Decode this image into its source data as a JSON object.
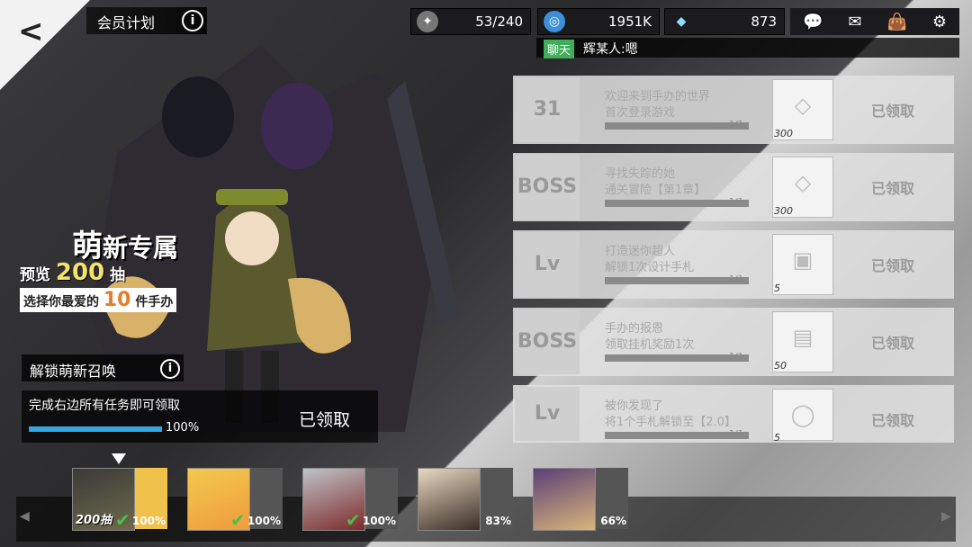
{
  "header": {
    "title": "会员计划"
  },
  "resources": [
    {
      "icon": "stamina-icon",
      "value": "53/240"
    },
    {
      "icon": "coin-icon",
      "value": "1951K"
    },
    {
      "icon": "diamond-icon",
      "value": "873"
    }
  ],
  "top_icons": [
    "chat-icon",
    "mail-icon",
    "bag-icon",
    "settings-icon"
  ],
  "chat": {
    "channel": "聊天",
    "message": "辉某人:嗯"
  },
  "promo": {
    "line1_big": "萌",
    "line1_rest": "新专属",
    "line2_prefix": "预览",
    "line2_num": "200",
    "line2_suffix": "抽",
    "line3_prefix": "选择你最爱的",
    "line3_num": "10",
    "line3_suffix": "件手办"
  },
  "unlock": {
    "label": "解锁萌新召唤"
  },
  "reward": {
    "desc": "完成右边所有任务即可领取",
    "progress": "100%",
    "progress_fraction": 1.0,
    "claim": "已领取"
  },
  "tasks": [
    {
      "icon": "calendar-icon",
      "line1": "欢迎来到手办的世界",
      "line2": "首次登录游戏",
      "count": "1/1",
      "item_icon": "diamond-icon",
      "qty": "300",
      "status": "已领取"
    },
    {
      "icon": "boss-icon",
      "line1": "寻找失踪的她",
      "line2": "通关冒险【第1章】",
      "count": "1/1",
      "item_icon": "diamond-icon",
      "qty": "300",
      "status": "已领取"
    },
    {
      "icon": "level-icon",
      "line1": "打造迷你超人",
      "line2": "解锁1次设计手札",
      "count": "1/1",
      "item_icon": "bottle-icon",
      "qty": "5",
      "status": "已领取"
    },
    {
      "icon": "boss-icon",
      "line1": "手办的报恩",
      "line2": "领取挂机奖励1次",
      "count": "1/1",
      "item_icon": "card-icon",
      "qty": "50",
      "status": "已领取"
    },
    {
      "icon": "level-icon",
      "line1": "被你发现了",
      "line2": "将1个手札解锁至【2.0】",
      "count": "1/1",
      "item_icon": "figure-head-icon",
      "qty": "5",
      "status": "已领取"
    }
  ],
  "icon_text": {
    "calendar-icon": "31",
    "boss-icon": "BOSS",
    "level-icon": "Lv"
  },
  "chips": [
    {
      "label": "200抽",
      "percent": "100%",
      "checked": true,
      "selected": true
    },
    {
      "percent": "100%",
      "checked": true
    },
    {
      "percent": "100%",
      "checked": true
    },
    {
      "percent": "83%",
      "checked": false
    },
    {
      "percent": "66%",
      "checked": false
    }
  ]
}
